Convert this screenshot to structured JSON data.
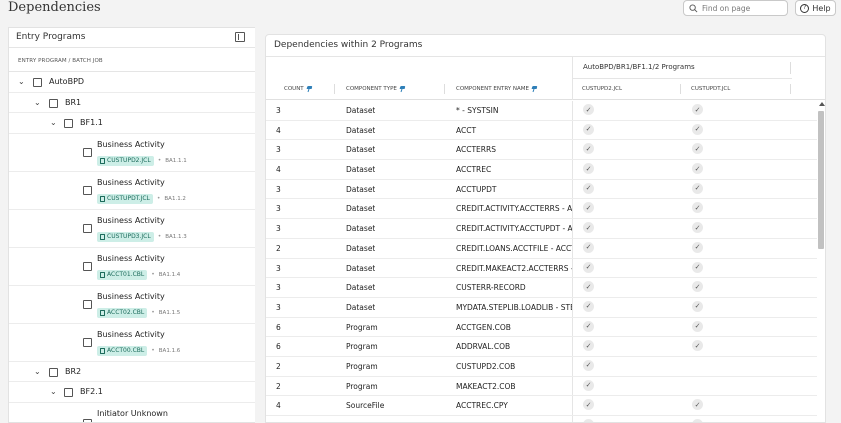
{
  "page": {
    "title": "Dependencies"
  },
  "search": {
    "placeholder": "Find on page"
  },
  "help": {
    "label": "Help"
  },
  "left_panel": {
    "title": "Entry Programs",
    "column_header": "ENTRY PROGRAM / BATCH JOB",
    "tree": {
      "root": "AutoBPD",
      "br1": "BR1",
      "bf11": "BF1.1",
      "leaves": [
        {
          "title": "Business Activity",
          "file": "CUSTUPD2.JCL",
          "batch": "BA1.1.1"
        },
        {
          "title": "Business Activity",
          "file": "CUSTUPDT.JCL",
          "batch": "BA1.1.2"
        },
        {
          "title": "Business Activity",
          "file": "CUSTUPD3.JCL",
          "batch": "BA1.1.3"
        },
        {
          "title": "Business Activity",
          "file": "ACCT01.CBL",
          "batch": "BA1.1.4"
        },
        {
          "title": "Business Activity",
          "file": "ACCT02.CBL",
          "batch": "BA1.1.5"
        },
        {
          "title": "Business Activity",
          "file": "ACCT00.CBL",
          "batch": "BA1.1.6"
        }
      ],
      "br2": "BR2",
      "bf21": "BF2.1",
      "last_leaf": "Initiator Unknown"
    }
  },
  "right_panel": {
    "title": "Dependencies within 2 Programs",
    "group_header": "AutoBPD/BR1/BF1.1/2 Programs",
    "columns": {
      "count": "COUNT",
      "type": "COMPONENT TYPE",
      "name": "COMPONENT ENTRY NAME",
      "p1": "CUSTUPD2.JCL",
      "p2": "CUSTUPDT.JCL"
    },
    "check_glyph": "✓",
    "rows": [
      {
        "count": "3",
        "type": "Dataset",
        "name": "* - SYSTSIN",
        "p1": true,
        "p2": true
      },
      {
        "count": "4",
        "type": "Dataset",
        "name": "ACCT",
        "p1": true,
        "p2": true
      },
      {
        "count": "3",
        "type": "Dataset",
        "name": "ACCTERRS",
        "p1": true,
        "p2": true
      },
      {
        "count": "4",
        "type": "Dataset",
        "name": "ACCTREC",
        "p1": true,
        "p2": true
      },
      {
        "count": "3",
        "type": "Dataset",
        "name": "ACCTUPDT",
        "p1": true,
        "p2": true
      },
      {
        "count": "3",
        "type": "Dataset",
        "name": "CREDIT.ACTIVITY.ACCTERRS - AC",
        "p1": true,
        "p2": true
      },
      {
        "count": "3",
        "type": "Dataset",
        "name": "CREDIT.ACTIVITY.ACCTUPDT - AC",
        "p1": true,
        "p2": true
      },
      {
        "count": "2",
        "type": "Dataset",
        "name": "CREDIT.LOANS.ACCTFILE - ACCT",
        "p1": true,
        "p2": true
      },
      {
        "count": "3",
        "type": "Dataset",
        "name": "CREDIT.MAKEACT2.ACCTERRS - A",
        "p1": true,
        "p2": true
      },
      {
        "count": "3",
        "type": "Dataset",
        "name": "CUSTERR-RECORD",
        "p1": true,
        "p2": true
      },
      {
        "count": "3",
        "type": "Dataset",
        "name": "MYDATA.STEPLIB.LOADLIB - STE",
        "p1": true,
        "p2": true
      },
      {
        "count": "6",
        "type": "Program",
        "name": "ACCTGEN.COB",
        "p1": true,
        "p2": true
      },
      {
        "count": "6",
        "type": "Program",
        "name": "ADDRVAL.COB",
        "p1": true,
        "p2": true
      },
      {
        "count": "2",
        "type": "Program",
        "name": "CUSTUPD2.COB",
        "p1": true,
        "p2": false
      },
      {
        "count": "2",
        "type": "Program",
        "name": "MAKEACT2.COB",
        "p1": true,
        "p2": false
      },
      {
        "count": "4",
        "type": "SourceFile",
        "name": "ACCTREC.CPY",
        "p1": true,
        "p2": true
      },
      {
        "count": "",
        "type": "",
        "name": "",
        "p1": true,
        "p2": true
      }
    ]
  }
}
